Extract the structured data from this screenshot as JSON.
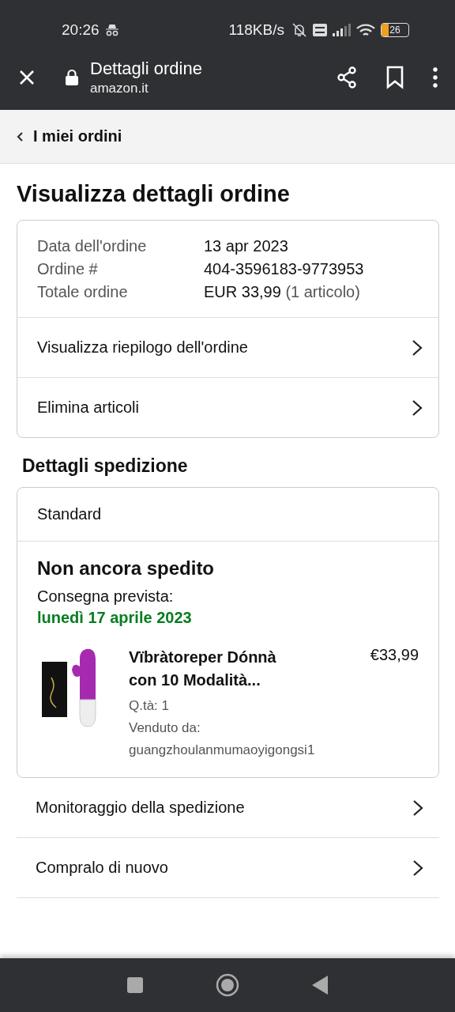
{
  "status_bar": {
    "time": "20:26",
    "speed": "118KB/s",
    "battery": "26"
  },
  "toolbar": {
    "title": "Dettagli ordine",
    "url": "amazon.it"
  },
  "breadcrumb": "I miei ordini",
  "page_title": "Visualizza dettagli ordine",
  "order_info": [
    {
      "label": "Data dell'ordine",
      "value": "13 apr 2023"
    },
    {
      "label": "Ordine #",
      "value": "404-3596183-9773953"
    },
    {
      "label": "Totale ordine",
      "value": "EUR 33,99",
      "note": "(1 articolo)"
    }
  ],
  "order_links": [
    "Visualizza riepilogo dell'ordine",
    "Elimina articoli"
  ],
  "shipping": {
    "heading": "Dettagli spedizione",
    "method": "Standard",
    "status": "Non ancora spedito",
    "delivery_label": "Consegna prevista:",
    "delivery_date": "lunedì 17 aprile 2023",
    "item": {
      "kind": "picture",
      "title": "Vïbràtoreper Dónnà con 10 Modalità...",
      "price": "€33,99",
      "quantity": "Q.tà: 1",
      "sold_by_label": "Venduto da:",
      "seller": "guangzhoulanmumaoyigongsi1"
    }
  },
  "shipping_links": [
    "Monitoraggio della spedizione",
    "Compralo di nuovo"
  ]
}
